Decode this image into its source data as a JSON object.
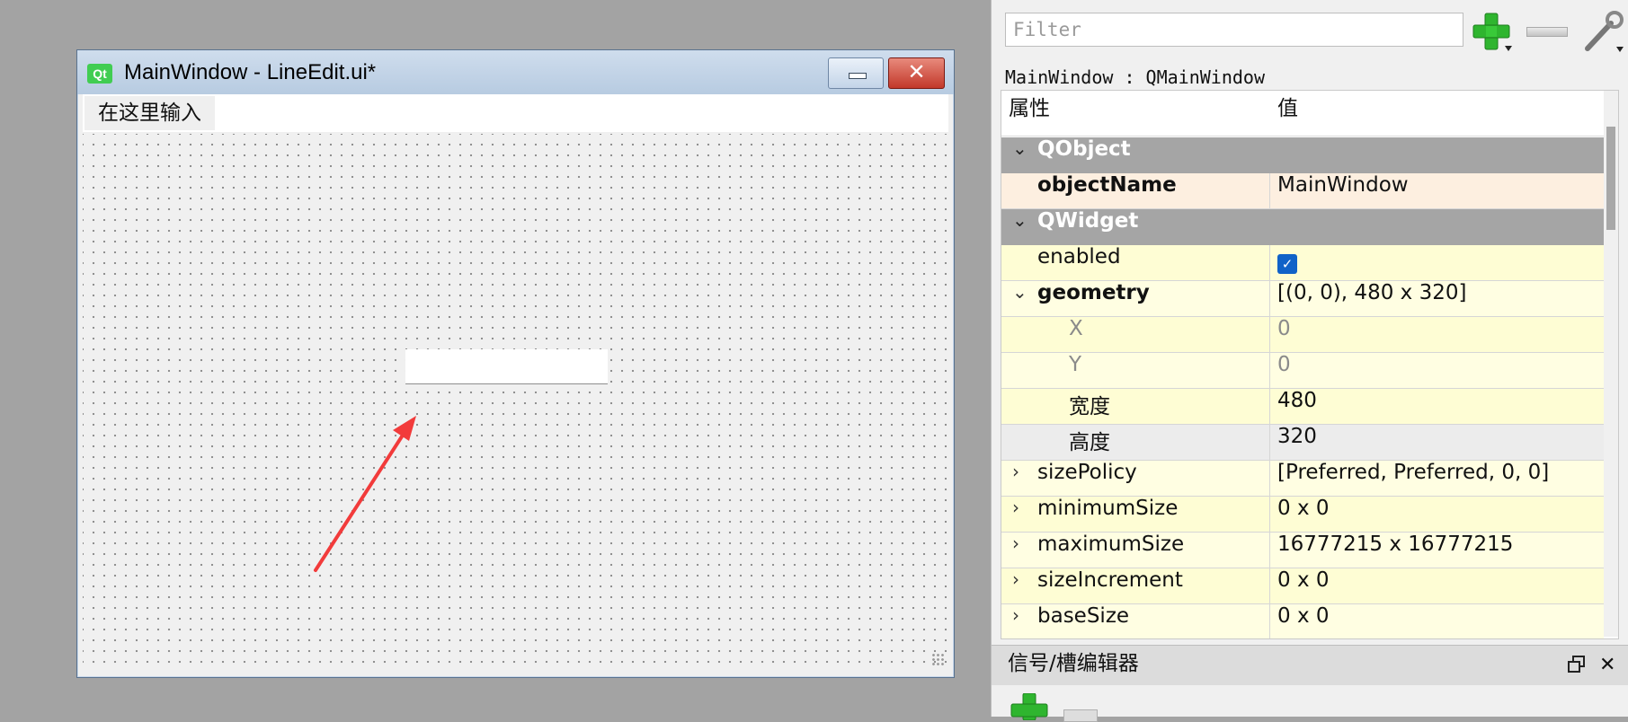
{
  "designer_window": {
    "logo_text": "Qt",
    "title": "MainWindow - LineEdit.ui*",
    "minimize_icon": "minimize-icon",
    "close_icon": "close-icon",
    "close_glyph": "✕",
    "menu_placeholder": "在这里输入"
  },
  "property_editor": {
    "filter_placeholder": "Filter",
    "object_label": "MainWindow : QMainWindow",
    "header": {
      "property": "属性",
      "value": "值"
    },
    "rows": [
      {
        "type": "group",
        "name": "QObject",
        "expand_glyph": "⌄"
      },
      {
        "type": "prop",
        "name": "objectName",
        "value": "MainWindow",
        "bold": true,
        "bg": "#fdefe0"
      },
      {
        "type": "group",
        "name": "QWidget",
        "expand_glyph": "⌄"
      },
      {
        "type": "prop",
        "name": "enabled",
        "checkbox": true,
        "checked_glyph": "✓",
        "bg": "#fefdd4"
      },
      {
        "type": "prop",
        "name": "geometry",
        "value": "[(0, 0), 480 x 320]",
        "bold": true,
        "expand_glyph": "⌄",
        "bg": "#fffee2"
      },
      {
        "type": "sub",
        "name": "X",
        "value": "0",
        "muted": true,
        "bg": "#fefdd4"
      },
      {
        "type": "sub",
        "name": "Y",
        "value": "0",
        "muted": true,
        "bg": "#fffee2"
      },
      {
        "type": "sub",
        "name": "宽度",
        "value": "480",
        "bg": "#fefdd4"
      },
      {
        "type": "sub",
        "name": "高度",
        "value": "320",
        "bg": "#ececec"
      },
      {
        "type": "prop",
        "name": "sizePolicy",
        "value": "[Preferred, Preferred, 0, 0]",
        "expand_glyph": "›",
        "bg": "#fffee2"
      },
      {
        "type": "prop",
        "name": "minimumSize",
        "value": "0 x 0",
        "expand_glyph": "›",
        "bg": "#fefdd4"
      },
      {
        "type": "prop",
        "name": "maximumSize",
        "value": "16777215 x 16777215",
        "expand_glyph": "›",
        "bg": "#fffee2"
      },
      {
        "type": "prop",
        "name": "sizeIncrement",
        "value": "0 x 0",
        "expand_glyph": "›",
        "bg": "#fefdd4"
      },
      {
        "type": "prop",
        "name": "baseSize",
        "value": "0 x 0",
        "expand_glyph": "›",
        "bg": "#fffee2"
      }
    ]
  },
  "signal_slot_editor": {
    "title": "信号/槽编辑器",
    "float_icon": "float-icon",
    "close_glyph": "✕"
  },
  "colors": {
    "arrow": "#f23b3b",
    "add_green": "#2fb52f",
    "checkbox_blue": "#1062c8"
  }
}
